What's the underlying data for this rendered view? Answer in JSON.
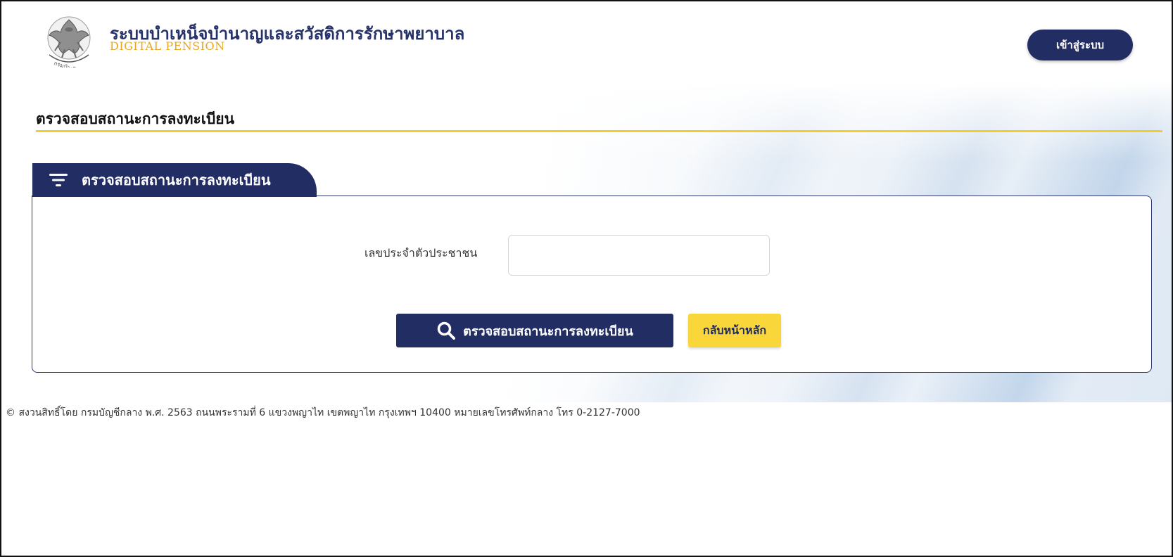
{
  "header": {
    "title": "ระบบบำเหน็จบำนาญและสวัสดิการรักษาพยาบาล",
    "subtitle": "DIGITAL PENSION",
    "login_label": "เข้าสู่ระบบ",
    "logo_icon": "comptroller-department-garuda-logo"
  },
  "page": {
    "title": "ตรวจสอบสถานะการลงทะเบียน"
  },
  "panel": {
    "tab_label": "ตรวจสอบสถานะการลงทะเบียน",
    "tab_icon": "filter-icon",
    "id_label": "เลขประจำตัวประชาชน",
    "id_value": "",
    "check_button_label": "ตรวจสอบสถานะการลงทะเบียน",
    "check_button_icon": "search-icon",
    "home_button_label": "กลับหน้าหลัก"
  },
  "footer": {
    "text": "© สงวนสิทธิ์โดย กรมบัญชีกลาง พ.ศ. 2563 ถนนพระรามที่ 6 แขวงพญาไท เขตพญาไท กรุงเทพฯ 10400 หมายเลขโทรศัพท์กลาง โทร 0-2127-7000"
  },
  "colors": {
    "primary": "#222d63",
    "accent": "#f5cd2a",
    "subtitle": "#e8a722"
  }
}
